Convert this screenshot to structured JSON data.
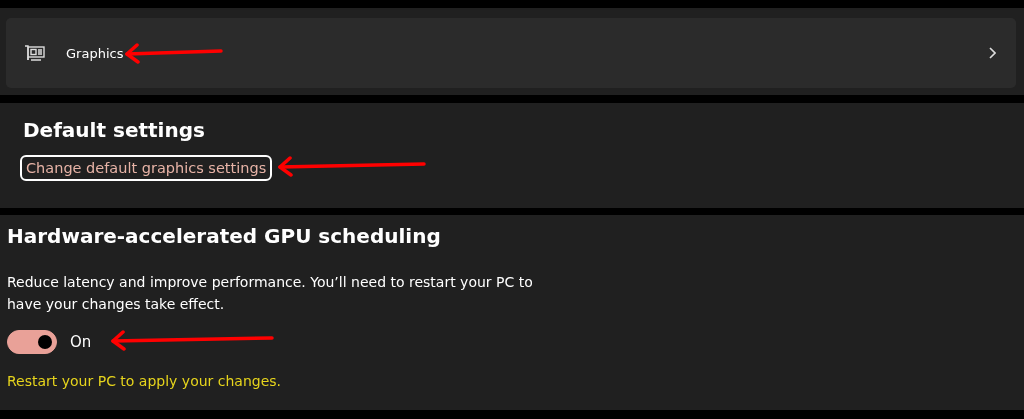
{
  "graphics_card": {
    "label": "Graphics"
  },
  "default_settings": {
    "heading": "Default settings",
    "link": "Change default graphics settings",
    "focused": true
  },
  "gpu_scheduling": {
    "heading": "Hardware-accelerated GPU scheduling",
    "description": "Reduce latency and improve performance. You’ll need to restart your PC to have your changes take effect.",
    "toggle": {
      "on": true,
      "label": "On"
    },
    "notice": "Restart your PC to apply your changes."
  }
}
